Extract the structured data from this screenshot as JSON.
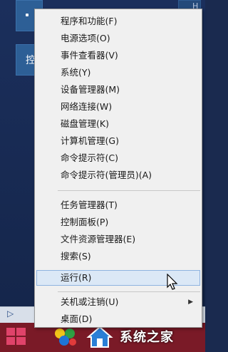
{
  "desktop": {
    "tile_label": "控",
    "ghost_label": "H"
  },
  "watermark": {
    "text": "系统之家"
  },
  "menu": {
    "groups": [
      [
        {
          "label": "程序和功能(F)"
        },
        {
          "label": "电源选项(O)"
        },
        {
          "label": "事件查看器(V)"
        },
        {
          "label": "系统(Y)"
        },
        {
          "label": "设备管理器(M)"
        },
        {
          "label": "网络连接(W)"
        },
        {
          "label": "磁盘管理(K)"
        },
        {
          "label": "计算机管理(G)"
        },
        {
          "label": "命令提示符(C)"
        },
        {
          "label": "命令提示符(管理员)(A)"
        }
      ],
      [
        {
          "label": "任务管理器(T)"
        },
        {
          "label": "控制面板(P)"
        },
        {
          "label": "文件资源管理器(E)"
        },
        {
          "label": "搜索(S)"
        },
        {
          "label": "运行(R)",
          "hover": true
        }
      ],
      [
        {
          "label": "关机或注销(U)",
          "submenu": true
        },
        {
          "label": "桌面(D)"
        }
      ]
    ]
  },
  "colors": {
    "menu_bg": "#f0f0f0",
    "hover_bg": "#dbe8f6",
    "taskbar": "#7a1a27"
  }
}
